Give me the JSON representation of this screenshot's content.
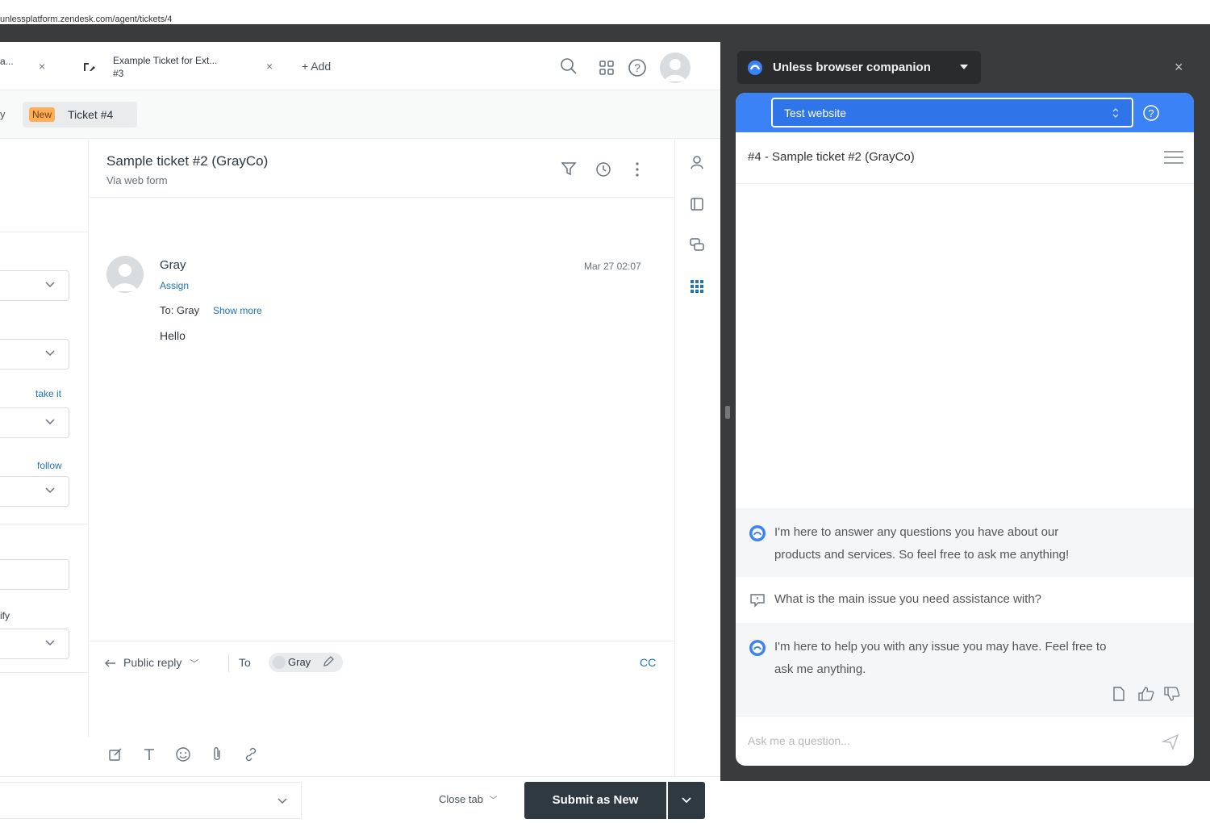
{
  "browser": {
    "url_fragment": "unlessplatform.zendesk.com/agent/tickets/4"
  },
  "tabs": [
    {
      "title": "Example Ticket for Ext...",
      "subtitle": "#3"
    }
  ],
  "tab_add_label": "+ Add",
  "breadcrumb": {
    "status_badge": "New",
    "current": "Ticket #4"
  },
  "properties": {
    "take_it_label": "take it",
    "follow_label": "follow",
    "partial_label": "ify"
  },
  "ticket": {
    "title": "Sample ticket #2 (GrayCo)",
    "via": "Via web form"
  },
  "message": {
    "author": "Gray",
    "assign_label": "Assign",
    "to_text": "To: Gray",
    "show_more_label": "Show more",
    "body": "Hello",
    "date": "Mar 27 02:07"
  },
  "composer": {
    "reply_type": "Public reply",
    "to_label": "To",
    "recipient": "Gray",
    "cc_label": "CC"
  },
  "footer": {
    "close_tab_label": "Close tab",
    "submit_label": "Submit as New"
  },
  "companion": {
    "title": "Unless browser companion",
    "site_select": "Test website",
    "context_title": "#4 - Sample ticket #2 (GrayCo)",
    "messages": [
      {
        "role": "bot",
        "text_line1": "I'm here to answer any questions you have about our",
        "text_line2": "products and services. So feel free to ask me anything!"
      },
      {
        "role": "prompt",
        "text_line1": "What is the main issue you need assistance with?"
      },
      {
        "role": "bot",
        "text_line1": "I'm here to help you with any issue you may have. Feel free to",
        "text_line2": "ask me anything."
      }
    ],
    "input_placeholder": "Ask me a question..."
  },
  "colors": {
    "accent_blue": "#3b82f6",
    "link_blue": "#1f73b7",
    "badge_orange": "#ffb057",
    "submit_dark": "#2f3941",
    "panel_dark": "#3a3b3d"
  }
}
